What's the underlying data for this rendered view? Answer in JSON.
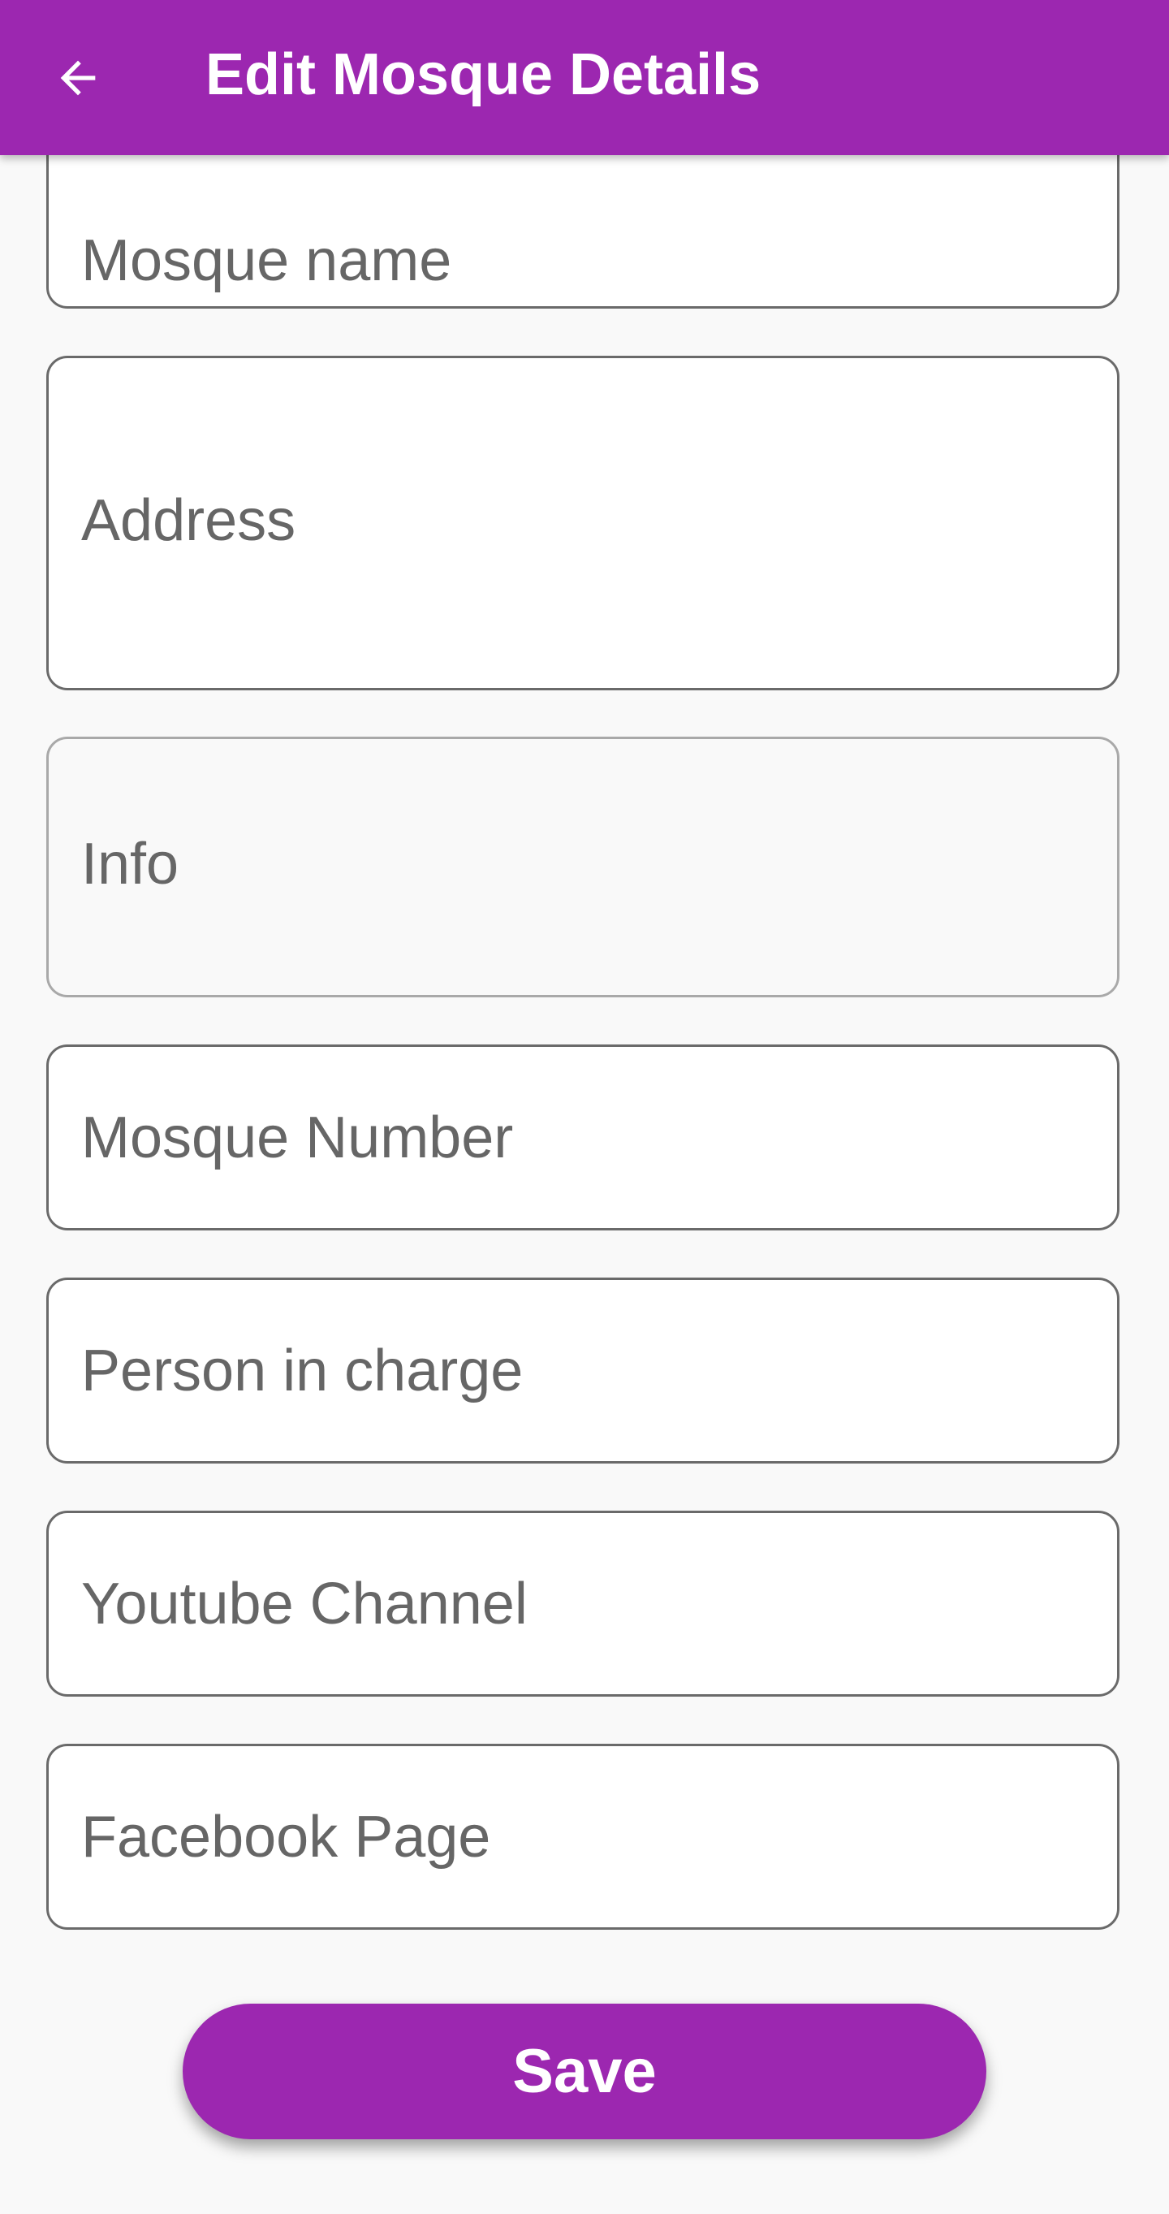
{
  "app_bar": {
    "title": "Edit Mosque Details",
    "back_icon": "arrow-back-icon",
    "background_color": "#9c27b0"
  },
  "form": {
    "mosque_name": {
      "placeholder": "Mosque name",
      "value": ""
    },
    "address": {
      "placeholder": "Address",
      "value": ""
    },
    "info": {
      "placeholder": "Info",
      "value": ""
    },
    "mosque_number": {
      "placeholder": "Mosque Number",
      "value": ""
    },
    "person_in_charge": {
      "placeholder": "Person in charge",
      "value": ""
    },
    "youtube_channel": {
      "placeholder": "Youtube Channel",
      "value": ""
    },
    "facebook_page": {
      "placeholder": "Facebook Page",
      "value": ""
    }
  },
  "save_button": {
    "label": "Save"
  }
}
